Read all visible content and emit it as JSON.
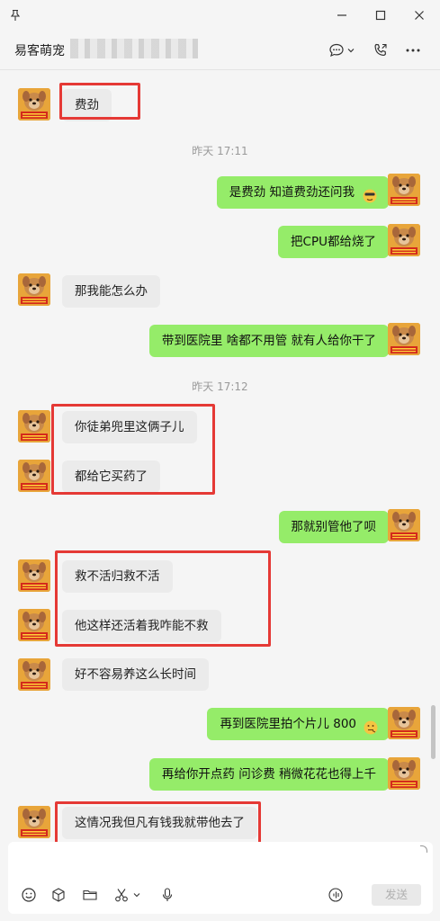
{
  "window": {
    "chat_name": "易客萌宠",
    "icons": [
      "pin-icon",
      "minimize-icon",
      "maximize-icon",
      "close-icon"
    ]
  },
  "header_icons": [
    "chat-bubble-icon",
    "chevron-down-icon",
    "phone-icon",
    "more-icon"
  ],
  "messages": {
    "m1": "费劲",
    "t1": "昨天 17:11",
    "m2": "是费劲 知道费劲还问我",
    "m3": "把CPU都给烧了",
    "m4": "那我能怎么办",
    "m5": "带到医院里 啥都不用管 就有人给你干了",
    "t2": "昨天 17:12",
    "m6": "你徒弟兜里这俩子儿",
    "m7": "都给它买药了",
    "m8": "那就别管他了呗",
    "m9": "救不活归救不活",
    "m10": "他这样还活着我咋能不救",
    "m11": "好不容易养这么长时间",
    "m12": "再到医院里拍个片儿 800",
    "m13": "再给你开点药 问诊费 稍微花花也得上千",
    "m14": "这情况我但凡有钱我就带他去了"
  },
  "composer": {
    "send_label": "发送",
    "icons": [
      "emoji-icon",
      "cube-icon",
      "folder-icon",
      "scissors-icon",
      "mic-icon",
      "voice-icon"
    ]
  },
  "colors": {
    "outgoing_bubble": "#95ec69",
    "incoming_bubble": "#ebebeb",
    "highlight": "#e53935"
  }
}
